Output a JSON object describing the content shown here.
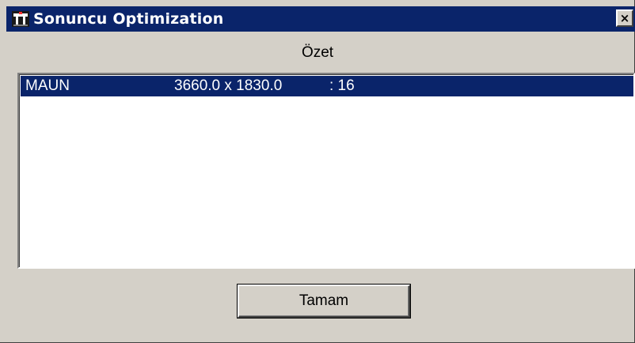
{
  "window": {
    "title": "Sonuncu Optimization",
    "close_label": "×"
  },
  "summary": {
    "label": "Özet"
  },
  "list": {
    "rows": [
      {
        "name": "MAUN",
        "dimensions": "3660.0 x 1830.0",
        "count": ": 16",
        "selected": true
      }
    ]
  },
  "buttons": {
    "ok_label": "Tamam"
  },
  "colors": {
    "titlebar": "#0a246a",
    "selection": "#0a246a",
    "face": "#d4d0c8"
  }
}
